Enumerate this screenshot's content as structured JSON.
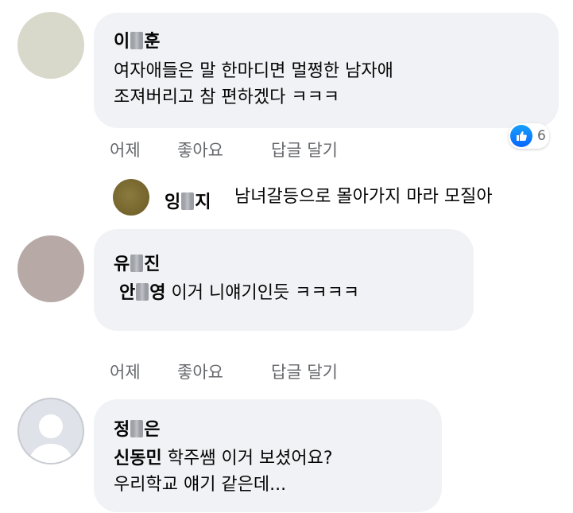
{
  "comments": [
    {
      "author_first": "이",
      "author_last": "훈",
      "lines": [
        "여자애들은 말 한마디면 멀쩡한 남자애",
        "조져버리고 참 편하겠다 ㅋㅋㅋ"
      ],
      "reaction_count": "6"
    },
    {
      "author_first": "유",
      "author_last": "진",
      "mention_first": "안",
      "mention_last": "영",
      "text": "이거 니얘기인듯 ㅋㅋㅋㅋ"
    },
    {
      "author_first": "정",
      "author_last": "은",
      "mention": "신동민",
      "line1": "학주쌤 이거 보셨어요?",
      "line2": "우리학교 얘기 같은데..."
    }
  ],
  "reply": {
    "author_first": "잉",
    "author_last": "지",
    "text": "남녀갈등으로 몰아가지 마라 모질아"
  },
  "actions": {
    "time": "어제",
    "like": "좋아요",
    "reply": "답글 달기"
  },
  "colors": {
    "bubble": "#f0f2f5",
    "secondary_text": "#65676b",
    "like_blue": "#0866ff"
  }
}
